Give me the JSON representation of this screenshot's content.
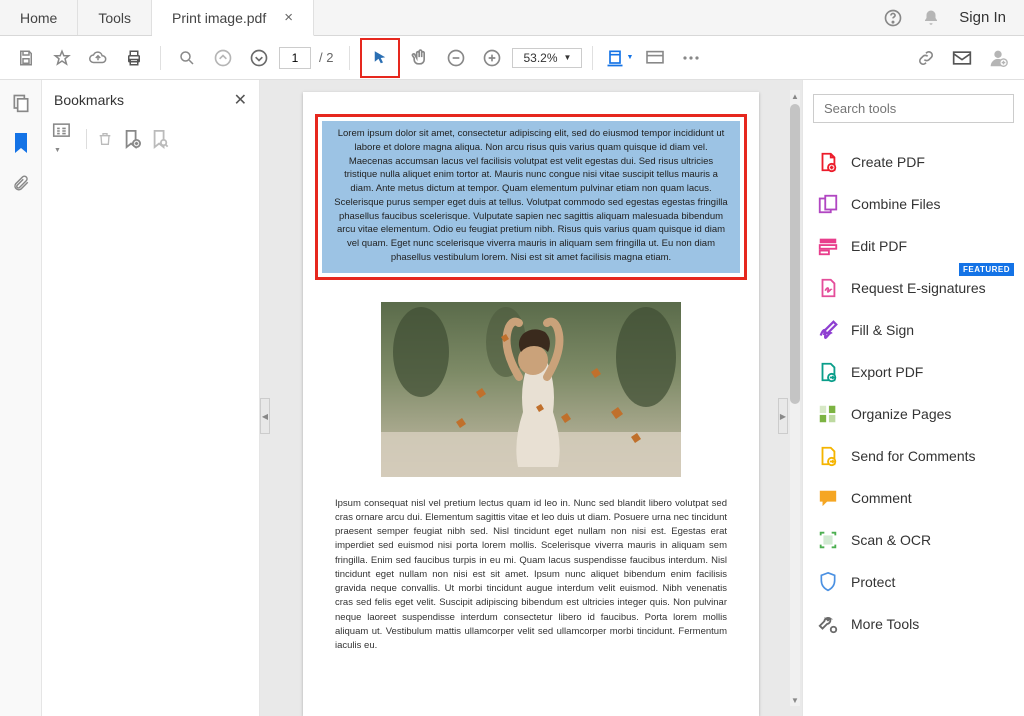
{
  "tabs": {
    "home": "Home",
    "tools": "Tools",
    "doc": "Print image.pdf"
  },
  "header": {
    "sign_in": "Sign In"
  },
  "toolbar": {
    "page_current": "1",
    "page_total": "/  2",
    "zoom": "53.2%"
  },
  "bookmarks": {
    "title": "Bookmarks"
  },
  "doc": {
    "selected_para": "Lorem ipsum dolor sit amet, consectetur adipiscing elit, sed do eiusmod tempor incididunt ut labore et dolore magna aliqua. Non arcu risus quis varius quam quisque id diam vel. Maecenas accumsan lacus vel facilisis volutpat est velit egestas dui. Sed risus ultricies tristique nulla aliquet enim tortor at. Mauris nunc congue nisi vitae suscipit tellus mauris a diam. Ante metus dictum at tempor. Quam elementum pulvinar etiam non quam lacus. Scelerisque purus semper eget duis at tellus. Volutpat commodo sed egestas egestas fringilla phasellus faucibus scelerisque. Vulputate sapien nec sagittis aliquam malesuada bibendum arcu vitae elementum. Odio eu feugiat pretium nibh. Risus quis varius quam quisque id diam vel quam. Eget nunc scelerisque viverra mauris in aliquam sem fringilla ut. Eu non diam phasellus vestibulum lorem. Nisi est sit amet facilisis magna etiam.",
    "body_para": "Ipsum consequat nisl vel pretium lectus quam id leo in. Nunc sed blandit libero volutpat sed cras ornare arcu dui. Elementum sagittis vitae et leo duis ut diam. Posuere urna nec tincidunt praesent semper feugiat nibh sed. Nisl tincidunt eget nullam non nisi est. Egestas erat imperdiet sed euismod nisi porta lorem mollis. Scelerisque viverra mauris in aliquam sem fringilla. Enim sed faucibus turpis in eu mi. Quam lacus suspendisse faucibus interdum. Nisl tincidunt eget nullam non nisi est sit amet. Ipsum nunc aliquet bibendum enim facilisis gravida neque convallis. Ut morbi tincidunt augue interdum velit euismod. Nibh venenatis cras sed felis eget velit. Suscipit adipiscing bibendum est ultricies integer quis. Non pulvinar neque laoreet suspendisse interdum consectetur libero id faucibus. Porta lorem mollis aliquam ut. Vestibulum mattis ullamcorper velit sed ullamcorper morbi tincidunt. Fermentum iaculis eu."
  },
  "search": {
    "placeholder": "Search tools"
  },
  "tools_panel": {
    "items": [
      {
        "label": "Create PDF",
        "color": "#ec1c2b"
      },
      {
        "label": "Combine Files",
        "color": "#b146c2"
      },
      {
        "label": "Edit PDF",
        "color": "#e83e8c"
      },
      {
        "label": "Request E-signatures",
        "color": "#e44d9a",
        "badge": "FEATURED"
      },
      {
        "label": "Fill & Sign",
        "color": "#8e3fd1"
      },
      {
        "label": "Export PDF",
        "color": "#0a9e8a"
      },
      {
        "label": "Organize Pages",
        "color": "#7cb342"
      },
      {
        "label": "Send for Comments",
        "color": "#f5b400"
      },
      {
        "label": "Comment",
        "color": "#f5a623"
      },
      {
        "label": "Scan & OCR",
        "color": "#4caf50"
      },
      {
        "label": "Protect",
        "color": "#4a90e2"
      },
      {
        "label": "More Tools",
        "color": "#6a6a6a"
      }
    ]
  }
}
